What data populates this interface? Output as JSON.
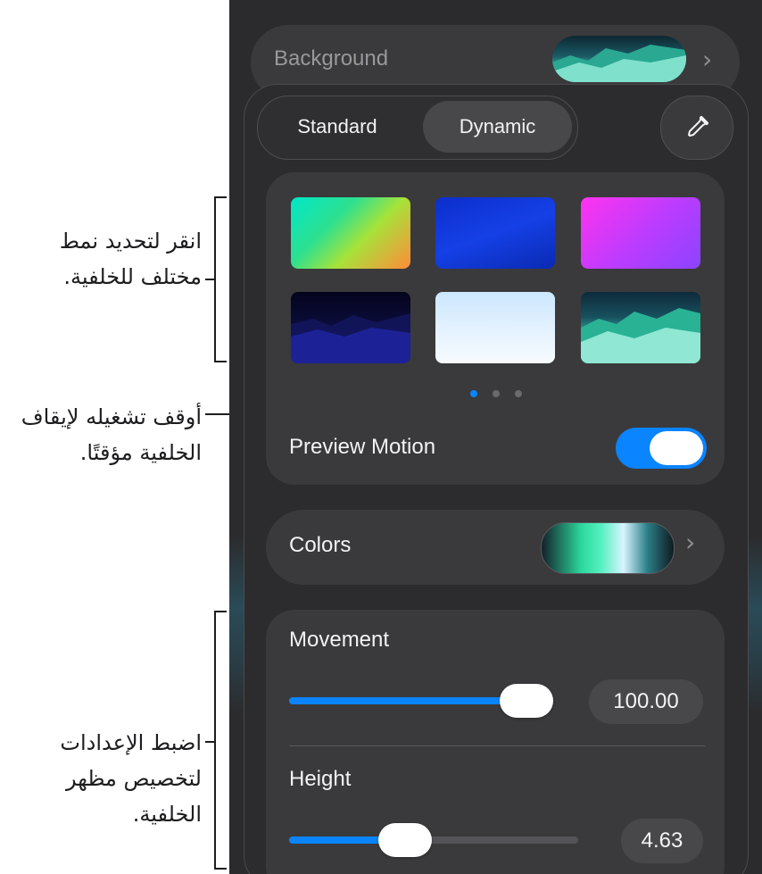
{
  "callouts": {
    "styles": {
      "line1": "انقر لتحديد نمط",
      "line2": "مختلف للخلفية."
    },
    "pause": {
      "line1": "أوقف تشغيله لإيقاف",
      "line2": "الخلفية مؤقتًا."
    },
    "adjust": {
      "line1": "اضبط الإعدادات",
      "line2": "لتخصيص مظهر",
      "line3": "الخلفية."
    }
  },
  "background_row": {
    "label": "Background"
  },
  "segmented": {
    "standard": "Standard",
    "dynamic": "Dynamic",
    "selected": "Dynamic"
  },
  "style_grid": {
    "swatches": [
      "gradient-green-yellow",
      "blue",
      "pink-purple",
      "dark-night-mountains",
      "light-sky",
      "teal-mountains"
    ],
    "page_count": 3,
    "current_page": 1
  },
  "preview_motion": {
    "label": "Preview Motion",
    "on": true
  },
  "colors": {
    "label": "Colors"
  },
  "movement": {
    "label": "Movement",
    "value": "100.00",
    "fraction": 1.0
  },
  "height": {
    "label": "Height",
    "value": "4.63",
    "fraction": 0.38
  },
  "theme": {
    "accent": "#0a84ff",
    "panel": "#2c2c2e",
    "card": "#3a3a3c"
  }
}
